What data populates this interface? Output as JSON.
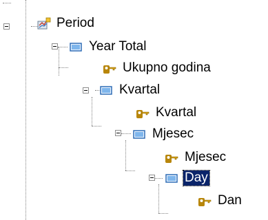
{
  "tree": {
    "nodes": [
      {
        "id": "period",
        "label": "Period",
        "icon": "dimension-icon",
        "expanded": true,
        "selected": false
      },
      {
        "id": "year-total",
        "label": "Year Total",
        "icon": "level-icon",
        "expanded": true,
        "selected": false
      },
      {
        "id": "ukupno-godina",
        "label": "Ukupno godina",
        "icon": "key-icon",
        "expanded": false,
        "selected": false
      },
      {
        "id": "kvartal-level",
        "label": "Kvartal",
        "icon": "level-icon",
        "expanded": true,
        "selected": false
      },
      {
        "id": "kvartal-key",
        "label": "Kvartal",
        "icon": "key-icon",
        "expanded": false,
        "selected": false
      },
      {
        "id": "mjesec-level",
        "label": "Mjesec",
        "icon": "level-icon",
        "expanded": true,
        "selected": false
      },
      {
        "id": "mjesec-key",
        "label": "Mjesec",
        "icon": "key-icon",
        "expanded": false,
        "selected": false
      },
      {
        "id": "day-level",
        "label": "Day",
        "icon": "level-icon",
        "expanded": true,
        "selected": true
      },
      {
        "id": "dan-key",
        "label": "Dan",
        "icon": "key-icon",
        "expanded": false,
        "selected": false
      }
    ]
  },
  "colors": {
    "selection": "#0a246a",
    "tree_lines": "#808080",
    "level_icon": "#4a90d9",
    "key_icon": "#d4a017"
  }
}
